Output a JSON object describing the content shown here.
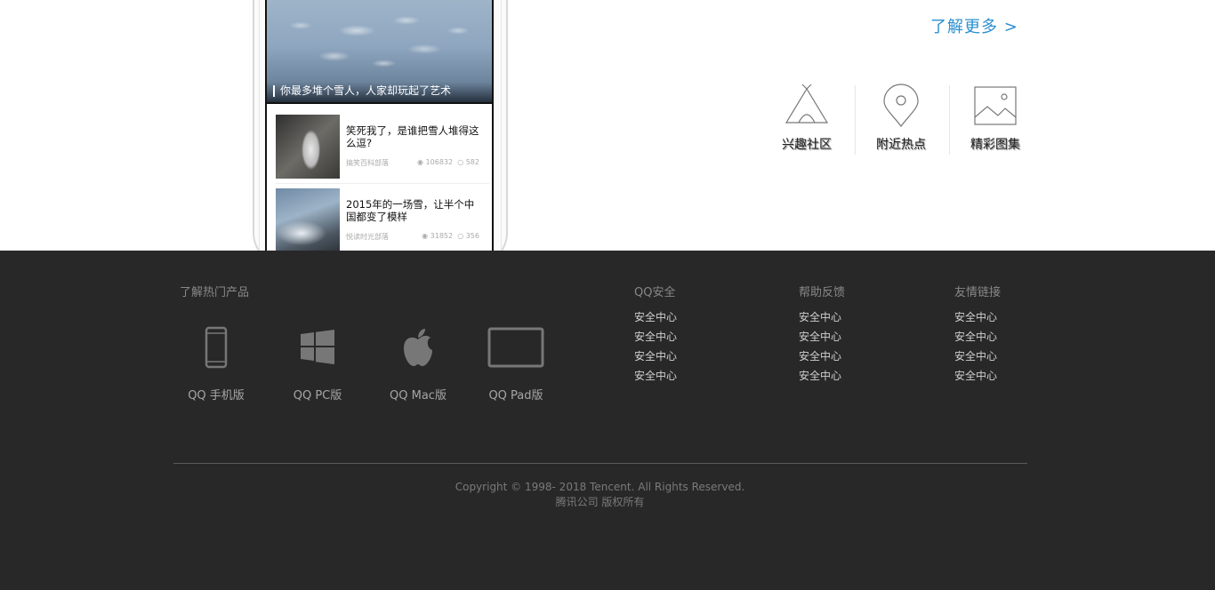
{
  "phone": {
    "hero_caption": "你最多堆个雪人，人家却玩起了艺术",
    "news": [
      {
        "title": "笑死我了，是谁把雪人堆得这么逗?",
        "source": "搞笑百科部落",
        "views": "106832",
        "comments": "582"
      },
      {
        "title": "2015年的一场雪，让半个中国都变了模样",
        "source": "悦读时光部落",
        "views": "31852",
        "comments": "356"
      }
    ]
  },
  "more_link": "了解更多 >",
  "features": [
    {
      "label": "兴趣社区",
      "icon": "tent-icon"
    },
    {
      "label": "附近热点",
      "icon": "location-pin-icon"
    },
    {
      "label": "精彩图集",
      "icon": "picture-icon"
    }
  ],
  "footer": {
    "products_title": "了解热门产品",
    "products": [
      {
        "label": "QQ 手机版",
        "icon": "phone-icon"
      },
      {
        "label": "QQ PC版",
        "icon": "windows-icon"
      },
      {
        "label": "QQ Mac版",
        "icon": "apple-icon"
      },
      {
        "label": "QQ Pad版",
        "icon": "tablet-icon"
      }
    ],
    "columns": [
      {
        "title": "QQ安全",
        "links": [
          "安全中心",
          "安全中心",
          "安全中心",
          "安全中心"
        ]
      },
      {
        "title": "帮助反馈",
        "links": [
          "安全中心",
          "安全中心",
          "安全中心",
          "安全中心"
        ]
      },
      {
        "title": "友情链接",
        "links": [
          "安全中心",
          "安全中心",
          "安全中心",
          "安全中心"
        ]
      }
    ],
    "copyright": "Copyright © 1998- 2018 Tencent. All Rights Reserved.",
    "company": "腾讯公司 版权所有"
  },
  "colors": {
    "link_blue": "#2a8fd0",
    "footer_bg": "#282828"
  }
}
